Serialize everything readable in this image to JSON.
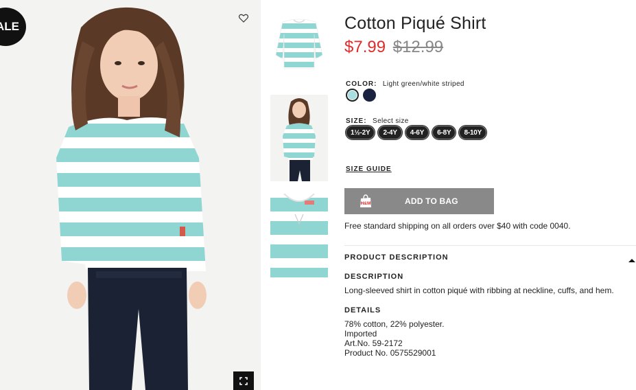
{
  "badge": {
    "sale_text": "ALE"
  },
  "product": {
    "title": "Cotton Piqué Shirt",
    "price_sale": "$7.99",
    "price_original": "$12.99"
  },
  "color": {
    "label": "COLOR:",
    "value": "Light green/white striped",
    "swatches": [
      {
        "name": "Light green/white striped",
        "hex": "#a9dfe0",
        "selected": true
      },
      {
        "name": "Dark blue",
        "hex": "#1a2240",
        "selected": false
      }
    ]
  },
  "size": {
    "label": "SIZE:",
    "value": "Select size",
    "options": [
      "1½-2Y",
      "2-4Y",
      "4-6Y",
      "6-8Y",
      "8-10Y"
    ]
  },
  "size_guide": "SIZE GUIDE",
  "cart": {
    "button_label": "ADD TO BAG",
    "icon": "hm-shopping-bag-icon"
  },
  "shipping_note": "Free standard shipping on all orders over $40 with code 0040.",
  "product_description": {
    "header": "PRODUCT DESCRIPTION",
    "description_heading": "DESCRIPTION",
    "description_text": "Long-sleeved shirt in cotton piqué with ribbing at neckline, cuffs, and hem.",
    "details_heading": "DETAILS",
    "details": [
      "78% cotton, 22% polyester.",
      "Imported",
      "Art.No. 59-2172",
      "Product No. 0575529001"
    ]
  },
  "icons": {
    "favorite": "heart-icon",
    "zoom": "expand-icon",
    "collapse": "caret-up-icon"
  },
  "colors": {
    "sale_red": "#e12b2b",
    "button_gray": "#898989",
    "stripe_aqua": "#8fd6d3"
  }
}
